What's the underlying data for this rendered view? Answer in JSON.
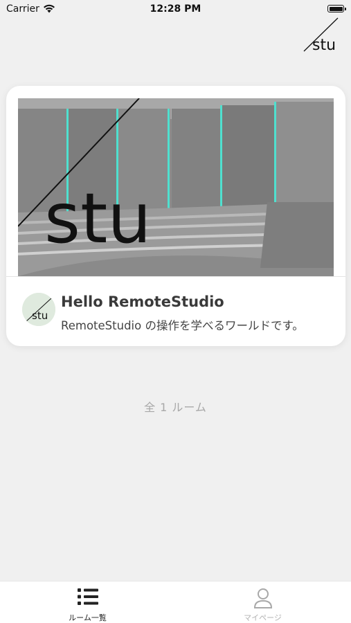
{
  "status_bar": {
    "carrier": "Carrier",
    "time": "12:28 PM"
  },
  "header": {
    "logo_text": "stu"
  },
  "rooms": [
    {
      "thumbnail_logo": "stu",
      "avatar_logo": "stu",
      "title": "Hello RemoteStudio",
      "description": "RemoteStudio の操作を学べるワールドです。"
    }
  ],
  "room_count_label": "全 1 ルーム",
  "tab_bar": {
    "tabs": [
      {
        "label": "ルーム一覧",
        "icon": "list-icon",
        "active": true
      },
      {
        "label": "マイページ",
        "icon": "person-icon",
        "active": false
      }
    ]
  },
  "colors": {
    "background": "#f0f0f0",
    "card": "#ffffff",
    "accent_cyan": "#4fe0cf",
    "active_tab": "#222222",
    "inactive_tab": "#b3b3b3"
  }
}
